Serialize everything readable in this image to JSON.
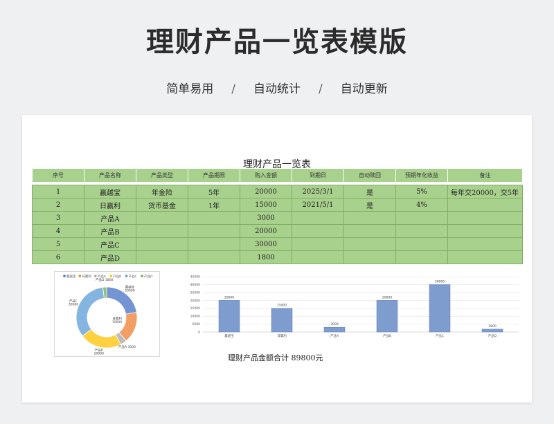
{
  "page": {
    "title": "理财产品一览表模版",
    "taglines": [
      "简单易用",
      "自动统计",
      "自动更新"
    ],
    "separator": "/"
  },
  "sheet": {
    "title": "理财产品一览表",
    "headers": [
      "序号",
      "产品名称",
      "产品类型",
      "产品期限",
      "购入金额",
      "到期日",
      "自动赎回",
      "预期年化收益",
      "备注"
    ],
    "rows": [
      [
        "1",
        "赢越宝",
        "年金险",
        "5年",
        "20000",
        "2025/3/1",
        "是",
        "5%",
        "每年交20000，交5年"
      ],
      [
        "2",
        "日赢利",
        "货币基金",
        "1年",
        "15000",
        "2021/5/1",
        "是",
        "4%",
        ""
      ],
      [
        "3",
        "产品A",
        "",
        "",
        "3000",
        "",
        "",
        "",
        ""
      ],
      [
        "4",
        "产品B",
        "",
        "",
        "20000",
        "",
        "",
        "",
        ""
      ],
      [
        "5",
        "产品C",
        "",
        "",
        "30000",
        "",
        "",
        "",
        ""
      ],
      [
        "6",
        "产品D",
        "",
        "",
        "1800",
        "",
        "",
        "",
        ""
      ]
    ],
    "total_text": "理财产品金额合计 89800元"
  },
  "chart_data": [
    {
      "type": "pie",
      "variant": "donut",
      "categories": [
        "赢越宝",
        "日赢利",
        "产品A",
        "产品B",
        "产品C",
        "产品D"
      ],
      "values": [
        20000,
        15000,
        3000,
        20000,
        30000,
        1800
      ],
      "data_labels": [
        "赢越宝\n20000",
        "日赢利\n15000",
        "产品A 3000",
        "产品B\n20000",
        "产品C\n30000",
        "产品D 1800"
      ],
      "colors": [
        "#4472c4",
        "#ed7d31",
        "#a5a5a5",
        "#ffc000",
        "#5b9bd5",
        "#70ad47"
      ],
      "legend": "top"
    },
    {
      "type": "bar",
      "categories": [
        "赢越宝",
        "日赢利",
        "产品A",
        "产品B",
        "产品C",
        "产品D"
      ],
      "values": [
        20000,
        15000,
        3000,
        20000,
        30000,
        1800
      ],
      "ylim": [
        0,
        35000
      ],
      "yticks": [
        0,
        5000,
        10000,
        15000,
        20000,
        25000,
        30000,
        35000
      ],
      "color": "#7f9ccf",
      "grid": true
    }
  ]
}
